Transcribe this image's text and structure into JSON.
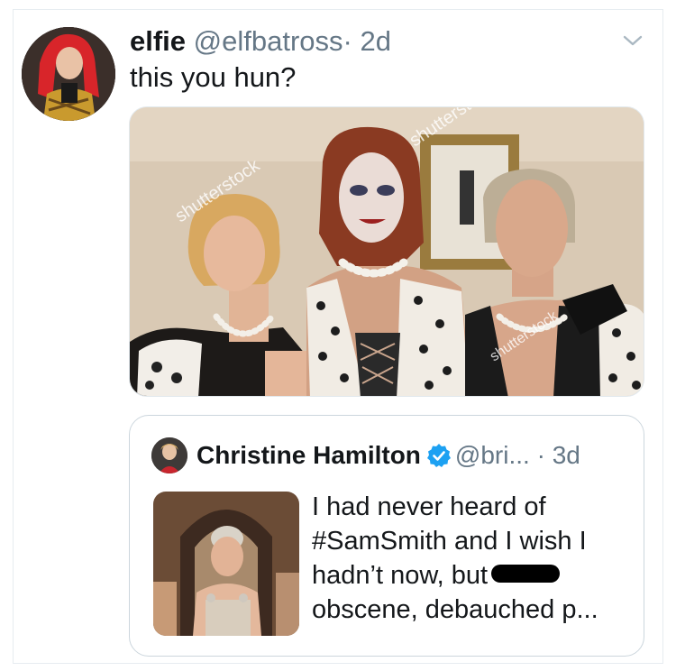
{
  "tweet": {
    "author_name": "elfie",
    "author_handle": "@elfbatross",
    "separator": "·",
    "time": "2d",
    "text": "this you hun?",
    "menu_icon": "chevron-down-icon",
    "media": {
      "watermarks": [
        "shutterstock",
        "shutterst",
        "shutterstock"
      ]
    }
  },
  "quoted_tweet": {
    "author_name": "Christine Hamilton",
    "verified_icon": "verified-badge-icon",
    "author_handle": "@bri...",
    "separator": "·",
    "time": "3d",
    "text_lines": [
      "I had never heard of",
      "#SamSmith and I wish I",
      "hadn’t now, but ",
      "obscene, debauched p..."
    ],
    "redacted": true
  },
  "colors": {
    "text_primary": "#14171a",
    "text_secondary": "#657786",
    "border": "#ccd6dd",
    "verified": "#1da1f2"
  }
}
